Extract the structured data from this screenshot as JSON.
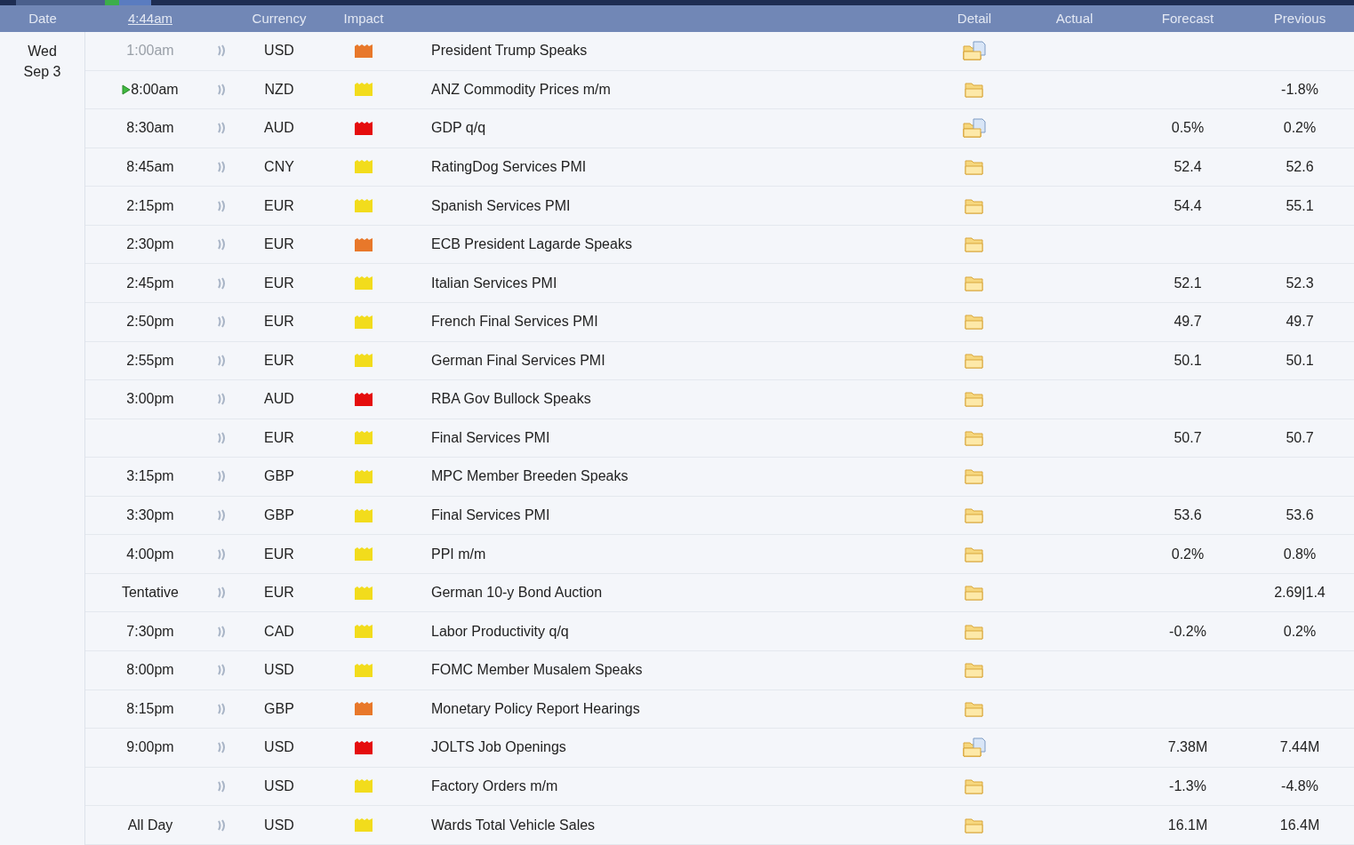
{
  "header": {
    "date": "Date",
    "time": "4:44am",
    "currency": "Currency",
    "impact": "Impact",
    "detail": "Detail",
    "actual": "Actual",
    "forecast": "Forecast",
    "previous": "Previous"
  },
  "day": {
    "weekday": "Wed",
    "date": "Sep 3"
  },
  "rows": [
    {
      "time": "1:00am",
      "past": true,
      "next": false,
      "currency": "USD",
      "color": "#e8782a",
      "kind": "folder-doc",
      "event": "President Trump Speaks",
      "forecast": "",
      "previous": ""
    },
    {
      "time": "8:00am",
      "past": false,
      "next": true,
      "currency": "NZD",
      "color": "#f2dc1c",
      "kind": "folder",
      "event": "ANZ Commodity Prices m/m",
      "forecast": "",
      "previous": "-1.8%"
    },
    {
      "time": "8:30am",
      "past": false,
      "next": false,
      "currency": "AUD",
      "color": "#e50d0d",
      "kind": "folder-doc",
      "event": "GDP q/q",
      "forecast": "0.5%",
      "previous": "0.2%"
    },
    {
      "time": "8:45am",
      "past": false,
      "next": false,
      "currency": "CNY",
      "color": "#f2dc1c",
      "kind": "folder",
      "event": "RatingDog Services PMI",
      "forecast": "52.4",
      "previous": "52.6"
    },
    {
      "time": "2:15pm",
      "past": false,
      "next": false,
      "currency": "EUR",
      "color": "#f2dc1c",
      "kind": "folder",
      "event": "Spanish Services PMI",
      "forecast": "54.4",
      "previous": "55.1"
    },
    {
      "time": "2:30pm",
      "past": false,
      "next": false,
      "currency": "EUR",
      "color": "#e8782a",
      "kind": "folder",
      "event": "ECB President Lagarde Speaks",
      "forecast": "",
      "previous": ""
    },
    {
      "time": "2:45pm",
      "past": false,
      "next": false,
      "currency": "EUR",
      "color": "#f2dc1c",
      "kind": "folder",
      "event": "Italian Services PMI",
      "forecast": "52.1",
      "previous": "52.3"
    },
    {
      "time": "2:50pm",
      "past": false,
      "next": false,
      "currency": "EUR",
      "color": "#f2dc1c",
      "kind": "folder",
      "event": "French Final Services PMI",
      "forecast": "49.7",
      "previous": "49.7"
    },
    {
      "time": "2:55pm",
      "past": false,
      "next": false,
      "currency": "EUR",
      "color": "#f2dc1c",
      "kind": "folder",
      "event": "German Final Services PMI",
      "forecast": "50.1",
      "previous": "50.1"
    },
    {
      "time": "3:00pm",
      "past": false,
      "next": false,
      "currency": "AUD",
      "color": "#e50d0d",
      "kind": "folder",
      "event": "RBA Gov Bullock Speaks",
      "forecast": "",
      "previous": ""
    },
    {
      "time": "",
      "next": false,
      "currency": "EUR",
      "color": "#f2dc1c",
      "kind": "folder",
      "event": "Final Services PMI",
      "forecast": "50.7",
      "previous": "50.7"
    },
    {
      "time": "3:15pm",
      "past": false,
      "next": false,
      "currency": "GBP",
      "color": "#f2dc1c",
      "kind": "folder",
      "event": "MPC Member Breeden Speaks",
      "forecast": "",
      "previous": ""
    },
    {
      "time": "3:30pm",
      "past": false,
      "next": false,
      "currency": "GBP",
      "color": "#f2dc1c",
      "kind": "folder",
      "event": "Final Services PMI",
      "forecast": "53.6",
      "previous": "53.6"
    },
    {
      "time": "4:00pm",
      "past": false,
      "next": false,
      "currency": "EUR",
      "color": "#f2dc1c",
      "kind": "folder",
      "event": "PPI m/m",
      "forecast": "0.2%",
      "previous": "0.8%"
    },
    {
      "time": "Tentative",
      "past": false,
      "next": false,
      "currency": "EUR",
      "color": "#f2dc1c",
      "kind": "folder",
      "event": "German 10-y Bond Auction",
      "forecast": "",
      "previous": "2.69|1.4"
    },
    {
      "time": "7:30pm",
      "past": false,
      "next": false,
      "currency": "CAD",
      "color": "#f2dc1c",
      "kind": "folder",
      "event": "Labor Productivity q/q",
      "forecast": "-0.2%",
      "previous": "0.2%"
    },
    {
      "time": "8:00pm",
      "past": false,
      "next": false,
      "currency": "USD",
      "color": "#f2dc1c",
      "kind": "folder",
      "event": "FOMC Member Musalem Speaks",
      "forecast": "",
      "previous": ""
    },
    {
      "time": "8:15pm",
      "past": false,
      "next": false,
      "currency": "GBP",
      "color": "#e8782a",
      "kind": "folder",
      "event": "Monetary Policy Report Hearings",
      "forecast": "",
      "previous": ""
    },
    {
      "time": "9:00pm",
      "past": false,
      "next": false,
      "currency": "USD",
      "color": "#e50d0d",
      "kind": "folder-doc",
      "event": "JOLTS Job Openings",
      "forecast": "7.38M",
      "previous": "7.44M"
    },
    {
      "time": "",
      "next": false,
      "currency": "USD",
      "color": "#f2dc1c",
      "kind": "folder",
      "event": "Factory Orders m/m",
      "forecast": "-1.3%",
      "previous": "-4.8%"
    },
    {
      "time": "All Day",
      "past": false,
      "next": false,
      "currency": "USD",
      "color": "#f2dc1c",
      "kind": "folder",
      "event": "Wards Total Vehicle Sales",
      "forecast": "16.1M",
      "previous": "16.4M"
    }
  ]
}
